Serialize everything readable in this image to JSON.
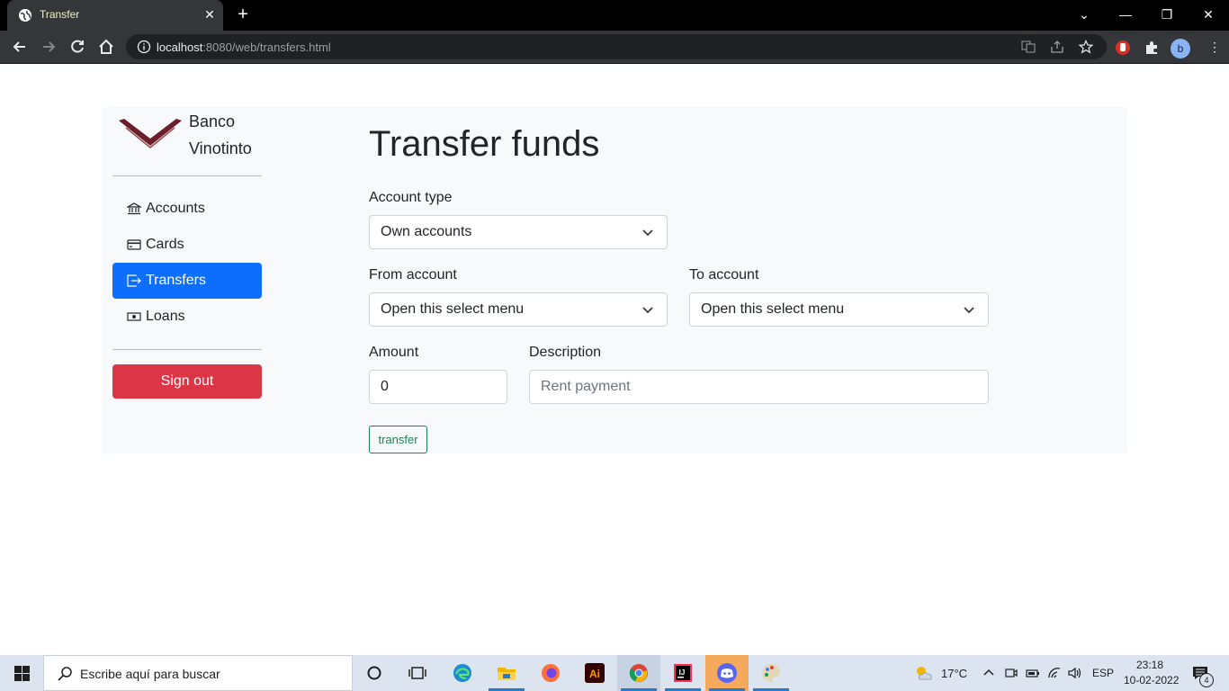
{
  "browser": {
    "tab_title": "Transfer",
    "url_host": "localhost",
    "url_rest": ":8080/web/transfers.html",
    "profile_initial": "b"
  },
  "sidebar": {
    "brand_line1": "Banco",
    "brand_line2": "Vinotinto",
    "items": [
      {
        "label": "Accounts",
        "icon": "bank-icon"
      },
      {
        "label": "Cards",
        "icon": "credit-card-icon"
      },
      {
        "label": "Transfers",
        "icon": "box-arrow-right-icon",
        "active": true
      },
      {
        "label": "Loans",
        "icon": "cash-icon"
      }
    ],
    "signout_label": "Sign out"
  },
  "main": {
    "title": "Transfer funds",
    "account_type_label": "Account type",
    "account_type_value": "Own accounts",
    "from_label": "From account",
    "from_value": "Open this select menu",
    "to_label": "To account",
    "to_value": "Open this select menu",
    "amount_label": "Amount",
    "amount_value": "0",
    "description_label": "Description",
    "description_placeholder": "Rent payment",
    "transfer_button": "transfer"
  },
  "taskbar": {
    "search_placeholder": "Escribe aquí para buscar",
    "temperature": "17°C",
    "language": "ESP",
    "time": "23:18",
    "date": "10-02-2022",
    "notification_count": "4"
  },
  "colors": {
    "primary": "#0d6efd",
    "danger": "#dc3545",
    "success": "#198754",
    "brand": "#6b1e2b"
  }
}
